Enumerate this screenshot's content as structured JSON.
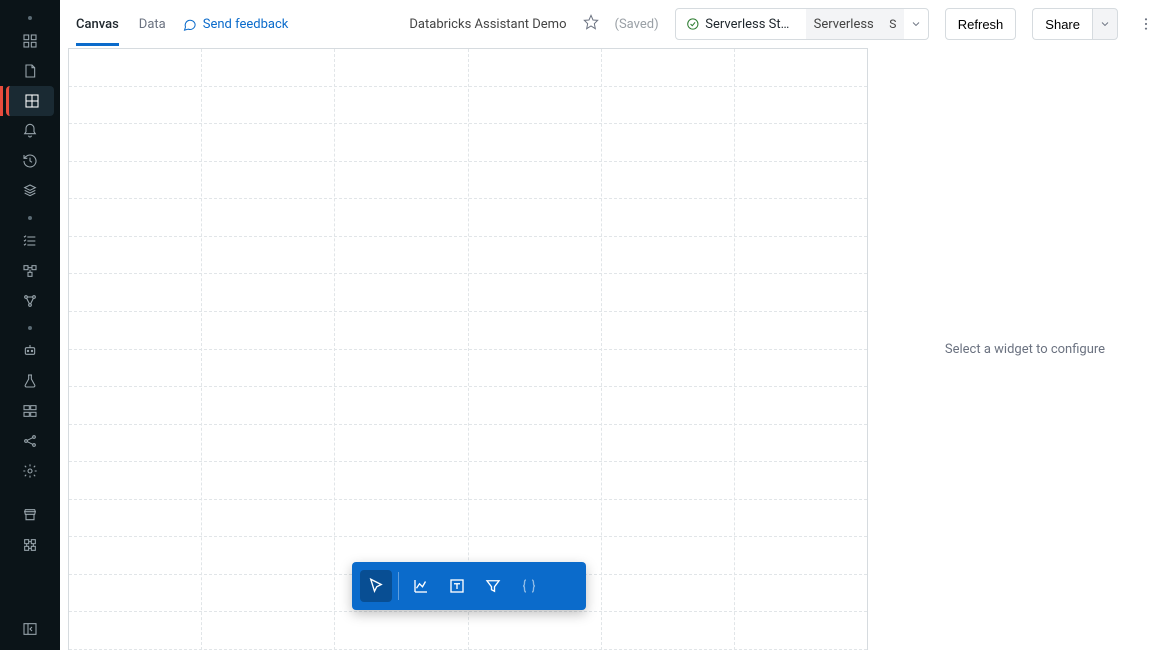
{
  "tabs": {
    "canvas": "Canvas",
    "data": "Data"
  },
  "feedback": {
    "label": "Send feedback"
  },
  "title": "Databricks Assistant Demo",
  "saved_label": "(Saved)",
  "cluster": {
    "status_name": "Serverless Sta...",
    "secondary": "Serverless",
    "avatar": "S"
  },
  "buttons": {
    "refresh": "Refresh",
    "share": "Share"
  },
  "right_panel": {
    "message": "Select a widget to configure"
  },
  "sidebar": {},
  "floating_toolbar": {
    "tools": [
      "cursor",
      "chart",
      "text",
      "filter",
      "code"
    ]
  }
}
